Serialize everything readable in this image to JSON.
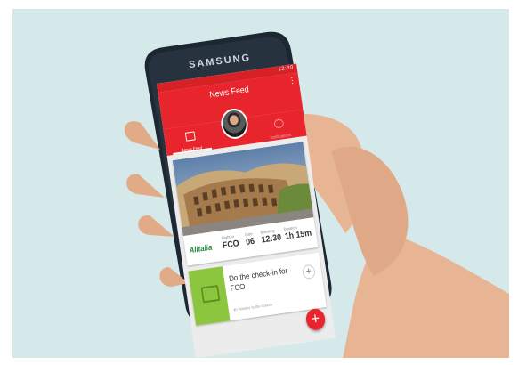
{
  "device": {
    "brand": "SAMSUNG"
  },
  "status_bar": {
    "time": "12:30"
  },
  "app_bar": {
    "title": "News Feed",
    "overflow_icon": "more-vert-icon"
  },
  "tabs": [
    {
      "label": "News Feed",
      "icon": "list-icon",
      "active": true
    },
    {
      "label": "Notifications",
      "icon": "bell-icon",
      "active": false
    }
  ],
  "flight_card": {
    "airline": "Alitalia",
    "fields": [
      {
        "label": "Flight to",
        "value": "FCO"
      },
      {
        "label": "Gate",
        "value": "06"
      },
      {
        "label": "Boarding",
        "value": "12:30"
      },
      {
        "label": "Duration",
        "value": "1h 15m"
      }
    ]
  },
  "checkin_card": {
    "title": "Do the check-in for FCO",
    "subtitle": "40 minutes to the closure",
    "add_label": "+"
  },
  "fab": {
    "label": "+"
  },
  "colors": {
    "accent": "#e8242c",
    "checkin": "#8cc63f",
    "background": "#d6e9ea"
  }
}
